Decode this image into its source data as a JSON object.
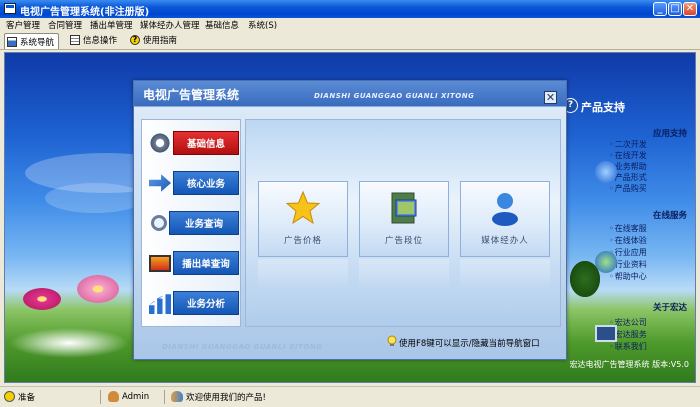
{
  "window": {
    "title": "电视广告管理系统(非注册版)",
    "buttons": [
      "_",
      "□",
      "✕"
    ]
  },
  "menu": [
    "客户管理",
    "合同管理",
    "播出单管理",
    "媒体经办人管理",
    "基础信息",
    "系统(S)"
  ],
  "tabs": [
    {
      "label": "系统导航",
      "icon": "navigation-icon",
      "active": true
    },
    {
      "label": "信息操作",
      "icon": "document-icon",
      "active": false
    },
    {
      "label": "使用指南",
      "icon": "help-icon",
      "active": false
    }
  ],
  "dialog": {
    "title": "电视广告管理系统",
    "pinyin": "DIANSHI GUANGGAO GUANLI XITONG",
    "close": "✕",
    "nav": [
      {
        "label": "基础信息",
        "icon": "gear-icon",
        "active": true
      },
      {
        "label": "核心业务",
        "icon": "arrow-right-icon",
        "active": false
      },
      {
        "label": "业务查询",
        "icon": "magnifier-icon",
        "active": false
      },
      {
        "label": "播出单查询",
        "icon": "monitor-icon",
        "active": false
      },
      {
        "label": "业务分析",
        "icon": "bar-chart-icon",
        "active": false
      }
    ],
    "tiles": [
      {
        "label": "广告价格",
        "icon": "star-icon"
      },
      {
        "label": "广告段位",
        "icon": "film-icon"
      },
      {
        "label": "媒体经办人",
        "icon": "user-icon"
      }
    ],
    "hint": "使用F8键可以显示/隐藏当前导航窗口",
    "footer_pinyin": "DIANSHI GUANGGAO GUANLI XITONG"
  },
  "support": {
    "title": "产品支持",
    "sections": [
      {
        "title": "应用支持",
        "items": [
          "二次开发",
          "在线开发",
          "业务帮助",
          "产品形式",
          "产品购买"
        ]
      },
      {
        "title": "在线服务",
        "items": [
          "在线客服",
          "在线体验",
          "行业应用",
          "行业资料",
          "帮助中心"
        ]
      },
      {
        "title": "关于宏达",
        "items": [
          "宏达公司",
          "宏达服务",
          "联系我们"
        ]
      }
    ],
    "footer": "宏达电视广告管理系统 版本:V5.0"
  },
  "status": [
    {
      "text": "准备",
      "icon": "info-icon"
    },
    {
      "text": "Admin",
      "icon": "user-icon"
    },
    {
      "text": "欢迎使用我们的产品!",
      "icon": "people-icon"
    }
  ],
  "colors": {
    "titlebar": "#0A56D8",
    "nav_active": "#D42020",
    "nav_default": "#1F64C4"
  }
}
